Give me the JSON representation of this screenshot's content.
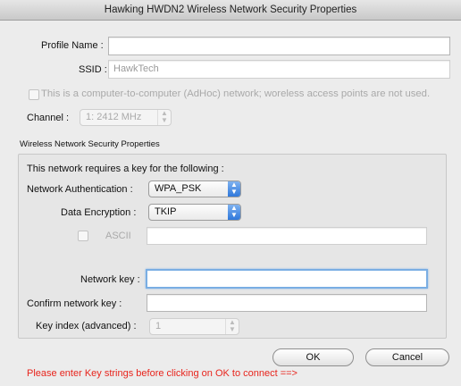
{
  "window": {
    "title": "Hawking HWDN2 Wireless Network Security Properties"
  },
  "profile": {
    "label": "Profile Name :",
    "value": ""
  },
  "ssid": {
    "label": "SSID :",
    "value": "HawkTech"
  },
  "adhoc": {
    "label": "This is a computer-to-computer (AdHoc) network; woreless access points are not used.",
    "checked": false
  },
  "channel": {
    "label": "Channel :",
    "value": "1: 2412 MHz"
  },
  "security": {
    "group_title": "Wireless Network Security Properties",
    "intro": "This network requires a key for the following :",
    "auth_label": "Network Authentication :",
    "auth_value": "WPA_PSK",
    "enc_label": "Data Encryption :",
    "enc_value": "TKIP",
    "ascii_label": "ASCII",
    "ascii_value": "",
    "netkey_label": "Network key :",
    "netkey_value": "",
    "confirm_label": "Confirm network key :",
    "confirm_value": "",
    "keyindex_label": "Key index (advanced) :",
    "keyindex_value": "1"
  },
  "buttons": {
    "ok": "OK",
    "cancel": "Cancel"
  },
  "message": "Please enter Key strings before clicking on OK to connect ==>",
  "icons": {
    "popup_arrows": "up-down-arrows-icon"
  }
}
